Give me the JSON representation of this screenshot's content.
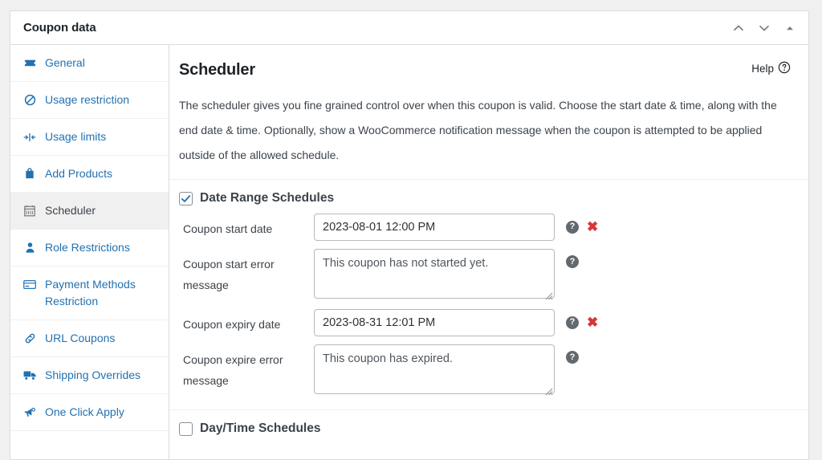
{
  "window": {
    "title": "Coupon data",
    "controls": [
      {
        "name": "move-up-icon",
        "glyph": "chevron-up"
      },
      {
        "name": "move-down-icon",
        "glyph": "chevron-down"
      },
      {
        "name": "toggle-panel-icon",
        "glyph": "triangle-up"
      }
    ]
  },
  "sidebar": {
    "items": [
      {
        "label": "General",
        "icon": "ticket-icon",
        "active": false
      },
      {
        "label": "Usage restriction",
        "icon": "no-entry-icon",
        "active": false
      },
      {
        "label": "Usage limits",
        "icon": "limits-icon",
        "active": false
      },
      {
        "label": "Add Products",
        "icon": "bag-icon",
        "active": false
      },
      {
        "label": "Scheduler",
        "icon": "calendar-icon",
        "active": true
      },
      {
        "label": "Role Restrictions",
        "icon": "user-icon",
        "active": false
      },
      {
        "label": "Payment Methods Restriction",
        "icon": "credit-card-icon",
        "active": false
      },
      {
        "label": "URL Coupons",
        "icon": "link-icon",
        "active": false
      },
      {
        "label": "Shipping Overrides",
        "icon": "truck-icon",
        "active": false
      },
      {
        "label": "One Click Apply",
        "icon": "megaphone-icon",
        "active": false
      }
    ]
  },
  "content": {
    "section_title": "Scheduler",
    "help_label": "Help",
    "description": "The scheduler gives you fine grained control over when this coupon is valid. Choose the start date & time, along with the end date & time. Optionally, show a WooCommerce notification message when the coupon is attempted to be applied outside of the allowed schedule.",
    "date_range": {
      "heading": "Date Range Schedules",
      "checked": true,
      "fields": [
        {
          "label": "Coupon start date",
          "type": "input",
          "value": "2023-08-01 12:00 PM",
          "has_help": true,
          "has_clear": true
        },
        {
          "label": "Coupon start error message",
          "type": "textarea",
          "value": "This coupon has not started yet.",
          "has_help": true,
          "has_clear": false
        },
        {
          "label": "Coupon expiry date",
          "type": "input",
          "value": "2023-08-31 12:01 PM",
          "has_help": true,
          "has_clear": true
        },
        {
          "label": "Coupon expire error message",
          "type": "textarea",
          "value": "This coupon has expired.",
          "has_help": true,
          "has_clear": false
        }
      ]
    },
    "day_time": {
      "heading": "Day/Time Schedules",
      "checked": false
    }
  },
  "colors": {
    "link_blue": "#2271b1",
    "accent_check": "#2271b1",
    "danger_red": "#d63638",
    "panel_border": "#dcdcde",
    "active_bg": "#f0f0f0"
  }
}
